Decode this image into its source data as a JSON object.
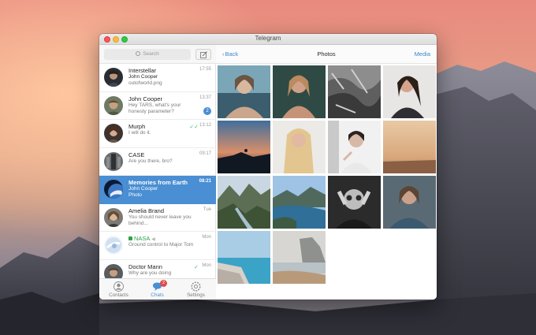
{
  "window": {
    "title": "Telegram"
  },
  "search": {
    "placeholder": "Search"
  },
  "chats": [
    {
      "name": "Interstellar",
      "sender": "John Cooper",
      "preview": "outofworld.png",
      "time": "17:55"
    },
    {
      "name": "John Cooper",
      "preview": "Hey TARS, what's your",
      "preview2": "honesty parameter?",
      "time": "13:37",
      "unread": "2"
    },
    {
      "name": "Murph",
      "preview": "I will do it.",
      "time": "13:12",
      "read": true
    },
    {
      "name": "CASE",
      "preview": "Are you there, bro?",
      "time": "09:17"
    },
    {
      "name": "Memories from Earth",
      "sender": "John Cooper",
      "preview": "Photo",
      "time": "08:21",
      "active": true
    },
    {
      "name": "Amelia Brand",
      "preview": "You should never leave you",
      "preview2": "behind...",
      "time": "Tue"
    },
    {
      "name": "NASA",
      "preview": "Ground control to Major Tom",
      "time": "Mon",
      "secret": true
    },
    {
      "name": "Doctor Mann",
      "preview": "Why are you doing",
      "time": "Mon",
      "read": true
    }
  ],
  "tabs": [
    {
      "label": "Contacts",
      "icon": "contacts-icon"
    },
    {
      "label": "Chats",
      "icon": "chats-icon",
      "badge": "2",
      "active": true
    },
    {
      "label": "Settings",
      "icon": "settings-icon"
    }
  ],
  "photos_header": {
    "back": "Back",
    "title": "Photos",
    "media": "Media"
  },
  "colors": {
    "accent": "#4a8ed3",
    "link": "#3a86d0",
    "secret_green": "#2fa24a",
    "badge_red": "#e14b4b"
  }
}
